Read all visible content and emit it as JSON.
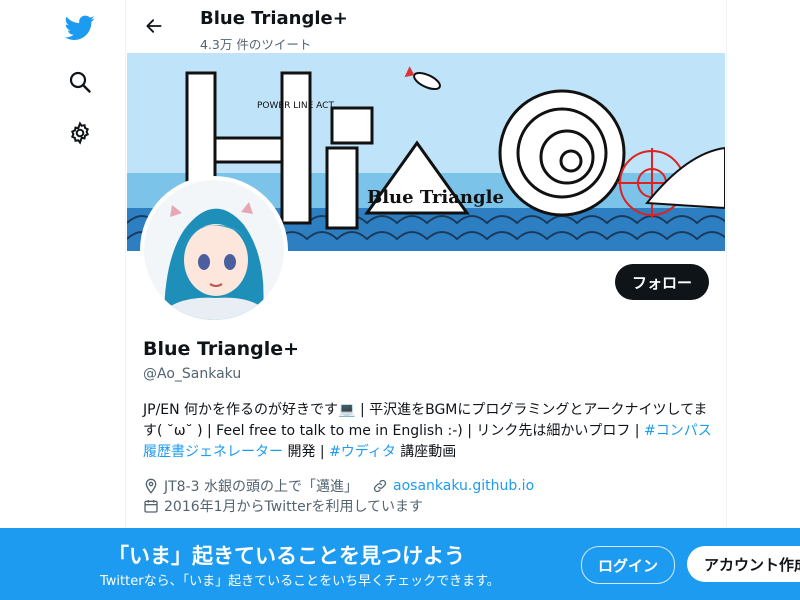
{
  "header": {
    "title": "Blue Triangle+",
    "tweet_count": "4.3万 件のツイート"
  },
  "banner": {
    "caption": "Blue Triangle",
    "title_letters": "UiAo",
    "tags": "POWER LINE ACT"
  },
  "profile": {
    "name": "Blue Triangle+",
    "handle": "@Ao_Sankaku",
    "follow_label": "フォロー",
    "bio_part1": "JP/EN 何かを作るのが好きです💻 | 平沢進をBGMにプログラミングとアークナイツしてます( ˘ω˘ ) | Feel free to talk to me in English :-) | リンク先は細かいプロフ | ",
    "bio_link1": "#コンパス履歴書ジェネレーター",
    "bio_part2": " 開発 | ",
    "bio_link2": "#ウディタ",
    "bio_part3": " 講座動画",
    "location": "JT8-3 水銀の頭の上で「邁進」",
    "website": "aosankaku.github.io",
    "joined": "2016年1月からTwitterを利用しています"
  },
  "bottom_bar": {
    "title": "「いま」起きていることを見つけよう",
    "subtitle": "Twitterなら、「いま」起きていることをいち早くチェックできます。",
    "login_label": "ログイン",
    "signup_label": "アカウント作成"
  },
  "colors": {
    "accent": "#1d9bf0",
    "text": "#0f1419",
    "muted": "#536471",
    "follow_button": "#0f1419"
  },
  "icons": [
    "twitter-bird-icon",
    "explore-icon",
    "settings-icon",
    "back-arrow-icon",
    "location-icon",
    "link-icon",
    "calendar-icon"
  ]
}
